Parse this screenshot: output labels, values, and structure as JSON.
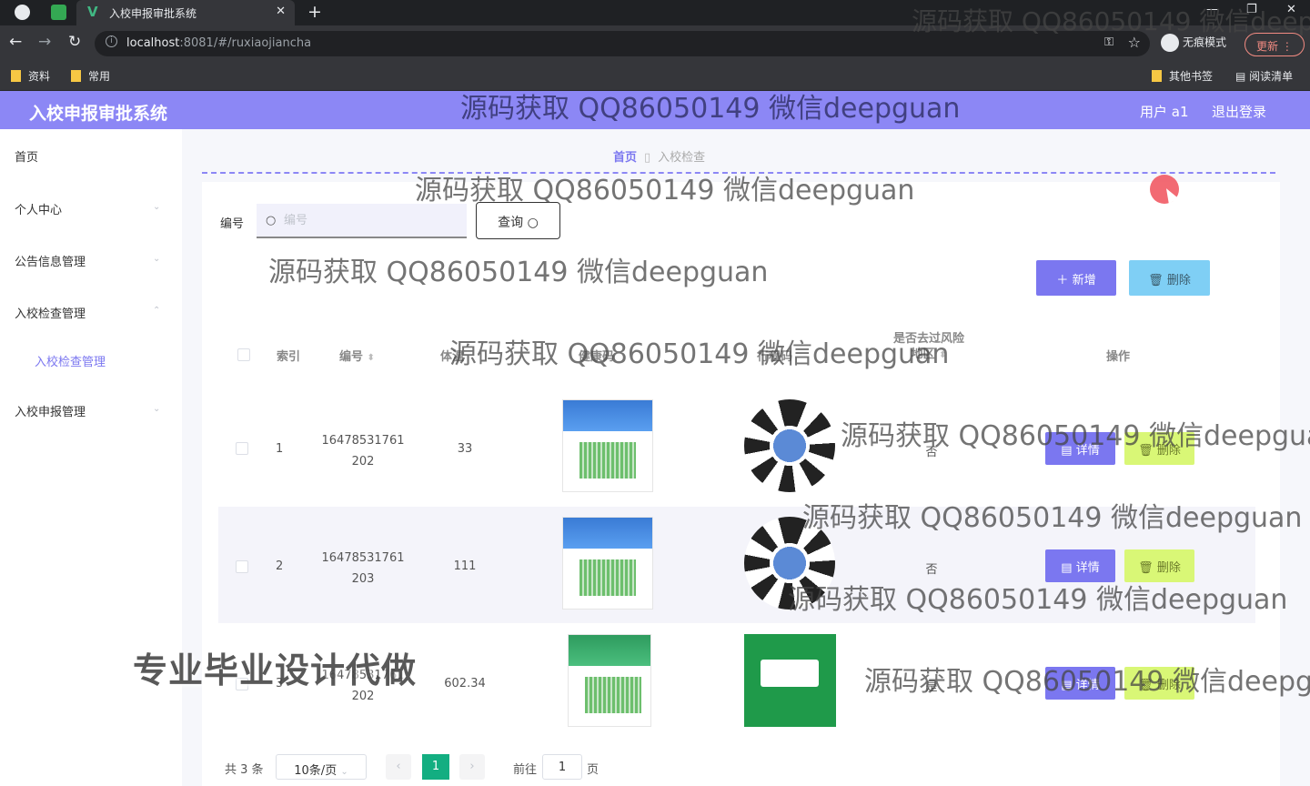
{
  "browser": {
    "tab_title": "入校申报审批系统",
    "url_host": "localhost",
    "url_rest": ":8081/#/ruxiaojiancha",
    "incognito_label": "无痕模式",
    "update_label": "更新",
    "bookmarks": [
      "资料",
      "常用"
    ],
    "bookmarks_right": [
      "其他书签",
      "阅读清单"
    ]
  },
  "header": {
    "title": "入校申报审批系统",
    "user": "用户 a1",
    "logout": "退出登录"
  },
  "sidebar": {
    "items": [
      {
        "label": "首页"
      },
      {
        "label": "个人中心"
      },
      {
        "label": "公告信息管理"
      },
      {
        "label": "入校检查管理"
      },
      {
        "label": "入校申报管理"
      }
    ],
    "sub_item": "入校检查管理"
  },
  "breadcrumb": {
    "home": "首页",
    "current": "入校检查"
  },
  "search": {
    "label": "编号",
    "placeholder": "编号",
    "button": "查询"
  },
  "toolbar": {
    "add": "新增",
    "delete": "删除"
  },
  "table": {
    "headers": {
      "index": "索引",
      "code": "编号",
      "col3": "体温",
      "col4": "健康码",
      "col5": "行程码",
      "risk_line1": "是否去过风险",
      "risk_line2": "地区",
      "ops": "操作"
    },
    "rows": [
      {
        "index": "1",
        "code1": "16478531761",
        "code2": "202",
        "temp": "33",
        "risk": "否"
      },
      {
        "index": "2",
        "code1": "16478531761",
        "code2": "203",
        "temp": "111",
        "risk": "否"
      },
      {
        "index": "3",
        "code1": "16478531761",
        "code2": "202",
        "temp": "602.34",
        "risk": "是"
      }
    ],
    "detail_label": "详情",
    "delete_label": "删除"
  },
  "pagination": {
    "total": "共 3 条",
    "page_size": "10条/页",
    "current": "1",
    "goto_prefix": "前往",
    "goto_value": "1",
    "goto_suffix": "页"
  },
  "watermark": {
    "text": "源码获取 QQ86050149 微信deepguan",
    "big": "专业毕业设计代做"
  }
}
